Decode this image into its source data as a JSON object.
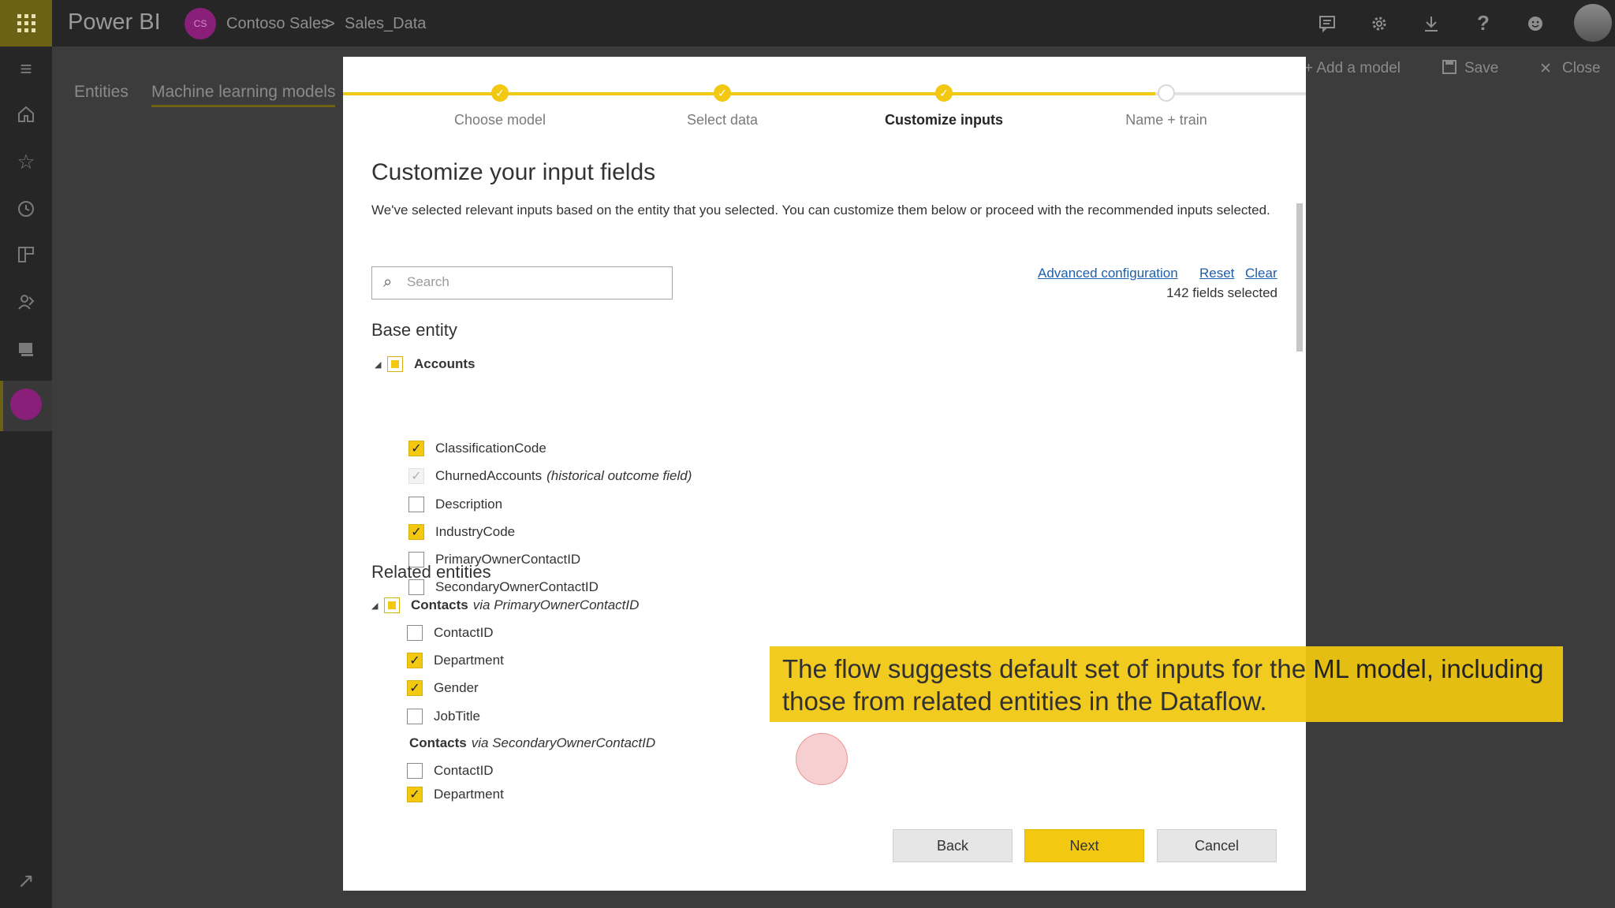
{
  "app": {
    "brand": "Power BI",
    "workspace_avatar": "CS",
    "breadcrumb": [
      "Contoso Sales",
      "Sales_Data"
    ],
    "breadcrumb_sep": ">",
    "accent": "#f2c811"
  },
  "topbar_icons": [
    "chat-icon",
    "gear-icon",
    "download-icon",
    "help-icon",
    "feedback-icon"
  ],
  "page": {
    "tabs": [
      "Entities",
      "Machine learning models"
    ],
    "commands": {
      "add_model": "+ Add a model",
      "save": "Save",
      "close": "Close"
    }
  },
  "dialog": {
    "steps": [
      {
        "label": "Choose model",
        "state": "done"
      },
      {
        "label": "Select data",
        "state": "done"
      },
      {
        "label": "Customize inputs",
        "state": "done-current"
      },
      {
        "label": "Name + train",
        "state": "todo"
      }
    ],
    "title": "Customize your input fields",
    "description": "We've selected relevant inputs based on the entity that you selected. You can customize them below or proceed with the recommended inputs selected.",
    "search_placeholder": "Search",
    "links": {
      "advanced": "Advanced configuration",
      "reset": "Reset",
      "clear": "Clear"
    },
    "fields_selected": "142 fields selected",
    "base_entity": {
      "heading": "Base entity",
      "group": "Accounts",
      "fields": [
        {
          "name": "ClassificationCode",
          "checked": true
        },
        {
          "name": "ChurnedAccounts",
          "note": "(historical outcome field)",
          "checked": true,
          "disabled": true
        },
        {
          "name": "Description",
          "checked": false
        },
        {
          "name": "IndustryCode",
          "checked": true
        },
        {
          "name": "PrimaryOwnerContactID",
          "checked": false
        },
        {
          "name": "SecondaryOwnerContactID",
          "checked": false
        }
      ]
    },
    "related_entities": {
      "heading": "Related entities",
      "groups": [
        {
          "name": "Contacts",
          "via": "via PrimaryOwnerContactID",
          "fields": [
            {
              "name": "ContactID",
              "checked": false
            },
            {
              "name": "Department",
              "checked": true
            },
            {
              "name": "Gender",
              "checked": true
            },
            {
              "name": "JobTitle",
              "checked": false
            }
          ]
        },
        {
          "name": "Contacts",
          "via": "via SecondaryOwnerContactID",
          "fields": [
            {
              "name": "ContactID",
              "checked": false
            },
            {
              "name": "Department",
              "checked": true
            }
          ]
        }
      ]
    },
    "buttons": {
      "back": "Back",
      "next": "Next",
      "cancel": "Cancel"
    }
  },
  "caption": "The flow suggests default set of inputs for the ML model, including those from related entities in the Dataflow."
}
